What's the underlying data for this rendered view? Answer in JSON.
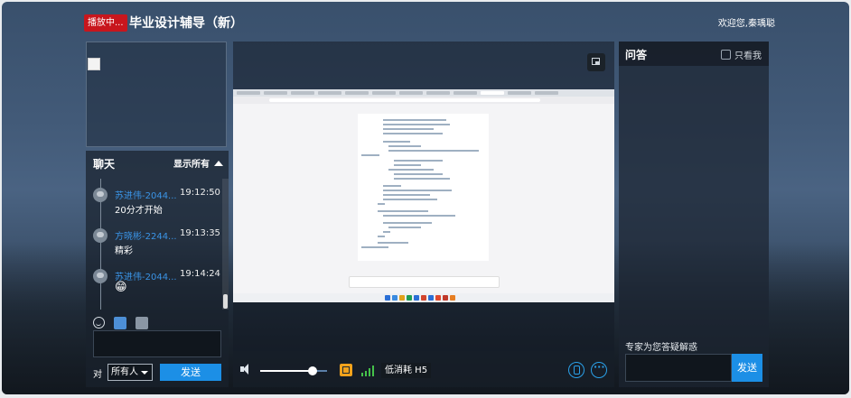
{
  "header": {
    "live_badge": "播放中...",
    "title": "毕业设计辅导（新）",
    "welcome": "欢迎您,秦瑀聪"
  },
  "chat": {
    "title": "聊天",
    "filter_label": "显示所有",
    "messages": [
      {
        "name": "苏进伟-2044...",
        "time": "19:12:50",
        "text": "20分才开始"
      },
      {
        "name": "方晓彬-2244...",
        "time": "19:13:35",
        "text": "精彩"
      },
      {
        "name": "苏进伟-2044...",
        "time": "19:14:24",
        "text": "😁"
      }
    ],
    "to_label": "对",
    "recipient": "所有人",
    "send_label": "发送"
  },
  "player": {
    "volume_fraction": 0.78,
    "quality_label": "低消耗 H5"
  },
  "qa": {
    "title": "问答",
    "only_me_label": "只看我",
    "hint": "专家为您答疑解惑",
    "send_label": "发送"
  },
  "colors": {
    "accent": "#1c8fe6",
    "live_badge": "#c8161d",
    "chat_name": "#3a94e6"
  }
}
